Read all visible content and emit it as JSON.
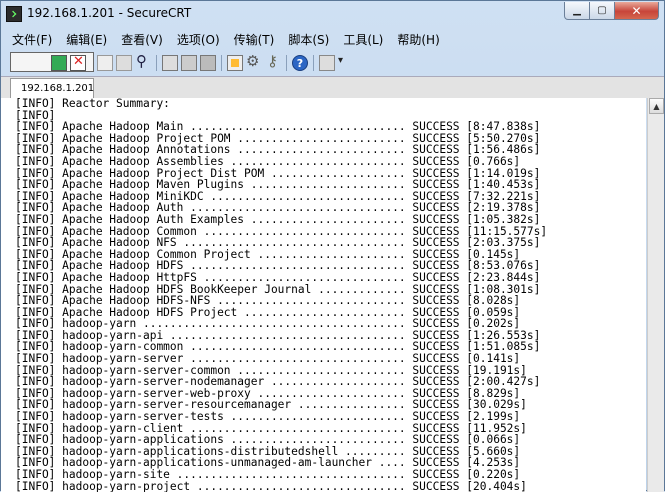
{
  "window": {
    "title": "192.168.1.201 - SecureCRT"
  },
  "menu": [
    "文件(F)",
    "编辑(E)",
    "查看(V)",
    "选项(O)",
    "传输(T)",
    "脚本(S)",
    "工具(L)",
    "帮助(H)"
  ],
  "toolbar": {
    "icons": [
      "connect-icon",
      "quick-connect-icon",
      "connect-in-tab-icon",
      "reconnect-icon",
      "disconnect-icon",
      "copy-icon",
      "paste-icon",
      "find-icon",
      "print-icon",
      "print-selection-icon",
      "print-setup-icon",
      "session-options-icon",
      "global-options-icon",
      "keymap-icon",
      "help-icon",
      "more-icon"
    ]
  },
  "tab": {
    "label": "192.168.1.201"
  },
  "terminal": {
    "lines": [
      "[INFO] Reactor Summary:",
      "[INFO]",
      "[INFO] Apache Hadoop Main ................................ SUCCESS [8:47.838s]",
      "[INFO] Apache Hadoop Project POM ......................... SUCCESS [5:50.270s]",
      "[INFO] Apache Hadoop Annotations ......................... SUCCESS [1:56.486s]",
      "[INFO] Apache Hadoop Assemblies .......................... SUCCESS [0.766s]",
      "[INFO] Apache Hadoop Project Dist POM .................... SUCCESS [1:14.019s]",
      "[INFO] Apache Hadoop Maven Plugins ....................... SUCCESS [1:40.453s]",
      "[INFO] Apache Hadoop MiniKDC ............................. SUCCESS [7:32.221s]",
      "[INFO] Apache Hadoop Auth ................................ SUCCESS [2:19.378s]",
      "[INFO] Apache Hadoop Auth Examples ....................... SUCCESS [1:05.382s]",
      "[INFO] Apache Hadoop Common .............................. SUCCESS [11:15.577s]",
      "[INFO] Apache Hadoop NFS ................................. SUCCESS [2:03.375s]",
      "[INFO] Apache Hadoop Common Project ...................... SUCCESS [0.145s]",
      "[INFO] Apache Hadoop HDFS ................................ SUCCESS [8:53.076s]",
      "[INFO] Apache Hadoop HttpFS .............................. SUCCESS [2:23.844s]",
      "[INFO] Apache Hadoop HDFS BookKeeper Journal ............. SUCCESS [1:08.301s]",
      "[INFO] Apache Hadoop HDFS-NFS ............................ SUCCESS [8.028s]",
      "[INFO] Apache Hadoop HDFS Project ........................ SUCCESS [0.059s]",
      "[INFO] hadoop-yarn ....................................... SUCCESS [0.202s]",
      "[INFO] hadoop-yarn-api ................................... SUCCESS [1:26.553s]",
      "[INFO] hadoop-yarn-common ................................ SUCCESS [1:51.085s]",
      "[INFO] hadoop-yarn-server ................................ SUCCESS [0.141s]",
      "[INFO] hadoop-yarn-server-common ......................... SUCCESS [19.191s]",
      "[INFO] hadoop-yarn-server-nodemanager .................... SUCCESS [2:00.427s]",
      "[INFO] hadoop-yarn-server-web-proxy ...................... SUCCESS [8.829s]",
      "[INFO] hadoop-yarn-server-resourcemanager ................ SUCCESS [30.029s]",
      "[INFO] hadoop-yarn-server-tests .......................... SUCCESS [2.199s]",
      "[INFO] hadoop-yarn-client ................................ SUCCESS [11.952s]",
      "[INFO] hadoop-yarn-applications .......................... SUCCESS [0.066s]",
      "[INFO] hadoop-yarn-applications-distributedshell ......... SUCCESS [5.660s]",
      "[INFO] hadoop-yarn-applications-unmanaged-am-launcher .... SUCCESS [4.253s]",
      "[INFO] hadoop-yarn-site .................................. SUCCESS [0.220s]",
      "[INFO] hadoop-yarn-project ............................... SUCCESS [20.404s]"
    ]
  }
}
